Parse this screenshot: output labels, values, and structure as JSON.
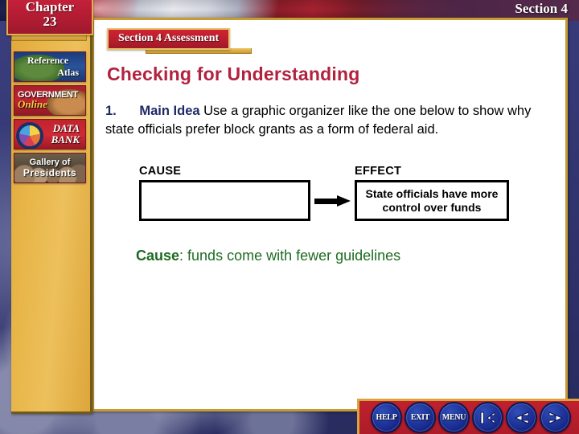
{
  "slide": {
    "chapter_line1": "Chapter",
    "chapter_line2": "23",
    "section_label": "Section 4",
    "assessment_label": "Section 4 Assessment",
    "page_title": "Checking for Understanding"
  },
  "sidebar": {
    "buttons": [
      {
        "name": "reference-atlas",
        "line1": "Reference",
        "line2": "Atlas"
      },
      {
        "name": "government-online",
        "line1": "GOVERNMENT",
        "line2": "Online"
      },
      {
        "name": "data-bank",
        "line1": "DATA",
        "line2": "BANK"
      },
      {
        "name": "gallery-of-presidents",
        "line1": "Gallery of",
        "line2": "Presidents"
      }
    ]
  },
  "question": {
    "number": "1.",
    "lead": "Main Idea",
    "text": "Use a graphic organizer like the one below to show why state officials prefer block grants as a form of federal aid."
  },
  "organizer": {
    "cause_label": "CAUSE",
    "effect_label": "EFFECT",
    "cause_box_text": "",
    "effect_box_text": "State officials have more control over funds"
  },
  "answer": {
    "label": "Cause",
    "text": ": funds come with fewer guidelines"
  },
  "nav": {
    "help_label": "HELP",
    "exit_label": "EXIT",
    "menu_label": "MENU",
    "first_icon": "first-page-arrow-icon",
    "back_icon": "back-arrow-icon",
    "forward_icon": "forward-arrow-icon"
  },
  "colors": {
    "title_red": "#b2223f",
    "answer_green": "#1d6b22",
    "question_blue": "#1d2a66",
    "banner_red": "#b81e2d",
    "gold": "#c79b33",
    "nav_blue": "#17288c"
  }
}
